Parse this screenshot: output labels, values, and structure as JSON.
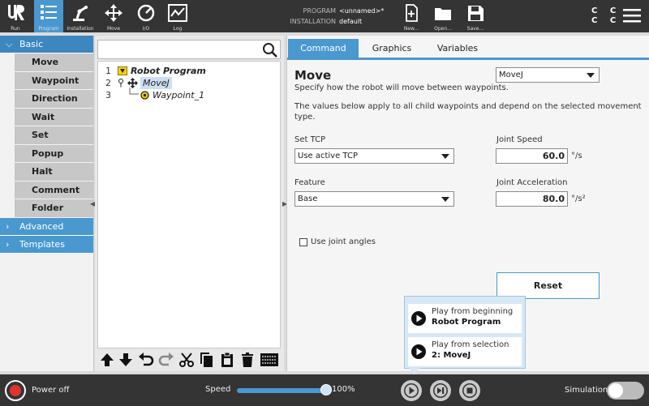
{
  "topbar": {
    "nav": [
      {
        "label": "Run",
        "icon": "ur-logo-icon"
      },
      {
        "label": "Program",
        "icon": "program-list-icon",
        "active": true
      },
      {
        "label": "Installation",
        "icon": "robot-arm-icon"
      },
      {
        "label": "Move",
        "icon": "move-arrows-icon"
      },
      {
        "label": "I/O",
        "icon": "io-gauge-icon"
      },
      {
        "label": "Log",
        "icon": "log-chart-icon"
      }
    ],
    "program_key": "PROGRAM",
    "program_value": "<unnamed>*",
    "installation_key": "INSTALLATION",
    "installation_value": "default",
    "actions": [
      {
        "label": "New...",
        "icon": "new-file-icon"
      },
      {
        "label": "Open...",
        "icon": "folder-icon"
      },
      {
        "label": "Save...",
        "icon": "save-icon"
      }
    ],
    "cc_text": "C C",
    "cc_text2": "C C",
    "menu_icon": "hamburger-menu-icon",
    "accent": "#4a98d0"
  },
  "leftnav": {
    "basic_label": "Basic",
    "basic_items": [
      "Move",
      "Waypoint",
      "Direction",
      "Wait",
      "Set",
      "Popup",
      "Halt",
      "Comment",
      "Folder"
    ],
    "advanced_label": "Advanced",
    "templates_label": "Templates"
  },
  "tree": {
    "rows": [
      {
        "num": "1",
        "label": "Robot Program"
      },
      {
        "num": "2",
        "label": "MoveJ"
      },
      {
        "num": "3",
        "label": "Waypoint_1"
      }
    ]
  },
  "tabs": [
    "Command",
    "Graphics",
    "Variables"
  ],
  "command": {
    "title": "Move",
    "move_type": "MoveJ",
    "desc1": "Specify how the robot will move between waypoints.",
    "desc2": "The values below apply to all child waypoints and depend on the selected movement",
    "desc3": "type.",
    "tcp_label": "Set TCP",
    "tcp_value": "Use active TCP",
    "feature_label": "Feature",
    "feature_value": "Base",
    "joint_speed_label": "Joint Speed",
    "joint_speed_value": "60.0",
    "joint_speed_unit": "°/s",
    "joint_accel_label": "Joint Acceleration",
    "joint_accel_value": "80.0",
    "joint_accel_unit": "°/s²",
    "joint_angles_label": "Use joint angles",
    "reset_label": "Reset"
  },
  "popup": {
    "item1_line1": "Play from beginning",
    "item1_line2": "Robot Program",
    "item2_line1": "Play from selection",
    "item2_line2": "2: MoveJ"
  },
  "bottombar": {
    "power_label": "Power off",
    "speed_label": "Speed",
    "speed_value": "100%",
    "speed_fraction": 1.0,
    "simulation_label": "Simulation",
    "power_color": "#e3312d"
  }
}
